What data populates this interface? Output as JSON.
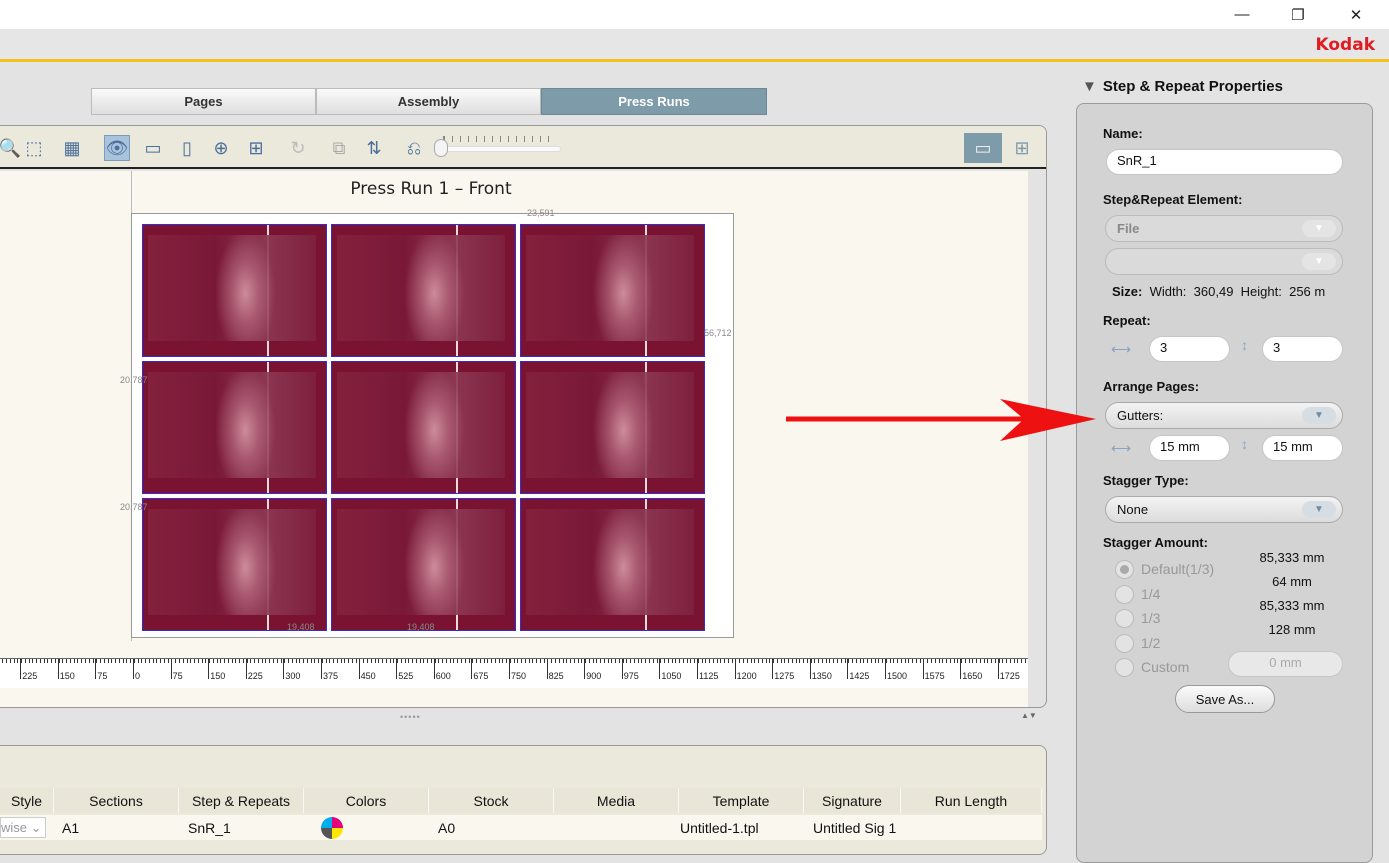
{
  "window": {
    "minimize": "—",
    "restore": "❐",
    "close": "✕",
    "brand": "Kodak"
  },
  "tabs": [
    {
      "label": "Pages"
    },
    {
      "label": "Assembly"
    },
    {
      "label": "Press Runs",
      "active": true
    }
  ],
  "canvas": {
    "title": "Press Run 1 – Front",
    "dimensions": {
      "top": "23,591",
      "right": "56,712",
      "left1": "20,787",
      "left2": "20,787",
      "bottom1": "19,408",
      "bottom2": "19,408"
    },
    "grid": {
      "cols": 3,
      "rows": 3
    }
  },
  "ruler": {
    "labels": [
      "225",
      "150",
      "75",
      "0",
      "75",
      "150",
      "225",
      "300",
      "375",
      "450",
      "525",
      "600",
      "675",
      "750",
      "825",
      "900",
      "975",
      "1050",
      "1125",
      "1200",
      "1275",
      "1350",
      "1425",
      "1500",
      "1575",
      "1650",
      "1725"
    ]
  },
  "table": {
    "headers": [
      "Style",
      "Sections",
      "Step & Repeats",
      "Colors",
      "Stock",
      "Media",
      "Template",
      "Signature",
      "Run Length"
    ],
    "row": {
      "style": "wise",
      "sections": "A1",
      "step_repeats": "SnR_1",
      "colors": "cmyk-icon",
      "stock": "A0",
      "media": "",
      "template": "Untitled-1.tpl",
      "signature": "Untitled Sig 1",
      "run_length": ""
    }
  },
  "properties": {
    "header": "Step & Repeat Properties",
    "name_label": "Name:",
    "name_value": "SnR_1",
    "element_label": "Step&Repeat Element:",
    "element_value": "File",
    "element_sub": "",
    "size_label": "Size:",
    "width_label": "Width:",
    "width_value": "360,49",
    "height_label": "Height:",
    "height_value": "256 m",
    "repeat_label": "Repeat:",
    "repeat_h": "3",
    "repeat_v": "3",
    "arrange_label": "Arrange Pages:",
    "arrange_value": "Gutters:",
    "gutter_h": "15 mm",
    "gutter_v": "15 mm",
    "stagger_type_label": "Stagger Type:",
    "stagger_type_value": "None",
    "stagger_amount_label": "Stagger Amount:",
    "stagger_options": [
      {
        "label": "Default(1/3)",
        "value": "85,333 mm",
        "checked": true
      },
      {
        "label": "1/4",
        "value": "64 mm"
      },
      {
        "label": "1/3",
        "value": "85,333 mm"
      },
      {
        "label": "1/2",
        "value": "128 mm"
      },
      {
        "label": "Custom",
        "value": "0 mm"
      }
    ],
    "save_as": "Save As..."
  },
  "colors": {
    "accent_tab": "#7d9ba9",
    "brand": "#e01b22",
    "tile": "#7a1332",
    "arrow": "#ee1111"
  }
}
